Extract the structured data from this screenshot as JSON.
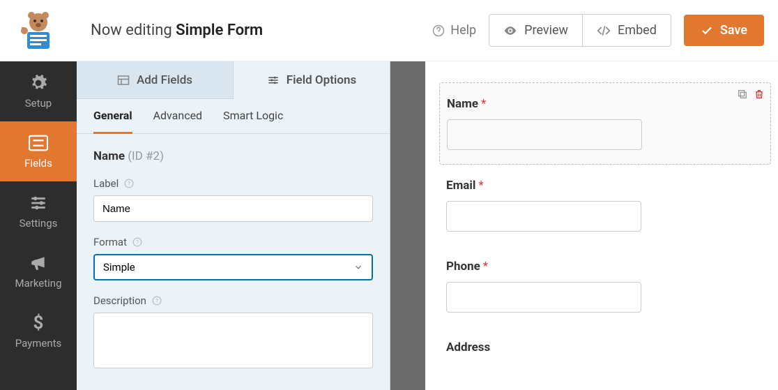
{
  "header": {
    "title_prefix": "Now editing",
    "title_name": "Simple Form",
    "help": "Help",
    "preview": "Preview",
    "embed": "Embed",
    "save": "Save"
  },
  "sidebar": {
    "items": [
      {
        "label": "Setup"
      },
      {
        "label": "Fields"
      },
      {
        "label": "Settings"
      },
      {
        "label": "Marketing"
      },
      {
        "label": "Payments"
      }
    ]
  },
  "panel": {
    "tabs": {
      "add": "Add Fields",
      "options": "Field Options"
    },
    "subtabs": {
      "general": "General",
      "advanced": "Advanced",
      "smart": "Smart Logic"
    },
    "field_name": "Name",
    "field_id": "(ID #2)",
    "labels": {
      "label": "Label",
      "format": "Format",
      "description": "Description"
    },
    "values": {
      "label": "Name",
      "format": "Simple"
    }
  },
  "preview": {
    "fields": [
      {
        "label": "Name",
        "required": true,
        "selected": true
      },
      {
        "label": "Email",
        "required": true
      },
      {
        "label": "Phone",
        "required": true
      },
      {
        "label": "Address"
      }
    ]
  }
}
